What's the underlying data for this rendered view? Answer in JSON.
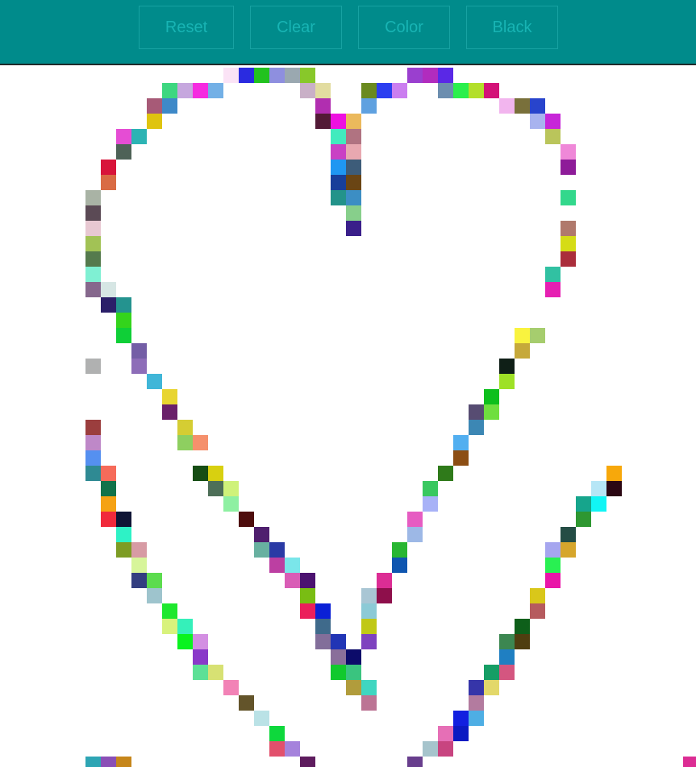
{
  "toolbar": {
    "reset_label": "Reset",
    "clear_label": "Clear",
    "color_label": "Color",
    "black_label": "Black",
    "background_color": "#008b8b",
    "button_text_color": "#18b4b4"
  },
  "canvas": {
    "background_color": "#ffffff",
    "pixels": [
      [
        "#fbe3f6",
        15,
        0
      ],
      [
        "#2a2be0",
        16,
        0
      ],
      [
        "#22c21f",
        17,
        0
      ],
      [
        "#8e8fdf",
        18,
        0
      ],
      [
        "#9aa8b0",
        19,
        0
      ],
      [
        "#88c82a",
        20,
        0
      ],
      [
        "#9a3fcf",
        27,
        0
      ],
      [
        "#b12cbe",
        28,
        0
      ],
      [
        "#5a28e6",
        29,
        0
      ],
      [
        "#3dd780",
        11,
        1
      ],
      [
        "#c6a7de",
        12,
        1
      ],
      [
        "#f52be0",
        13,
        1
      ],
      [
        "#73b0e6",
        14,
        1
      ],
      [
        "#c9b0c7",
        20,
        1
      ],
      [
        "#e2dca0",
        21,
        1
      ],
      [
        "#6a8a1f",
        24,
        1
      ],
      [
        "#2c3ef0",
        25,
        1
      ],
      [
        "#cb7ef0",
        26,
        1
      ],
      [
        "#6c8eaf",
        29,
        1
      ],
      [
        "#2bef4c",
        30,
        1
      ],
      [
        "#b3df2b",
        31,
        1
      ],
      [
        "#d31278",
        32,
        1
      ],
      [
        "#a75a77",
        10,
        2
      ],
      [
        "#3e89c8",
        11,
        2
      ],
      [
        "#b12eb0",
        21,
        2
      ],
      [
        "#5fa1e0",
        24,
        2
      ],
      [
        "#f2b5ee",
        33,
        2
      ],
      [
        "#79703b",
        34,
        2
      ],
      [
        "#2844cc",
        35,
        2
      ],
      [
        "#dfc40f",
        10,
        3
      ],
      [
        "#521a36",
        21,
        3
      ],
      [
        "#ee10e0",
        22,
        3
      ],
      [
        "#ebb95c",
        23,
        3
      ],
      [
        "#a8b3ef",
        35,
        3
      ],
      [
        "#c726d8",
        36,
        3
      ],
      [
        "#e54dd4",
        8,
        4
      ],
      [
        "#2cb4b4",
        9,
        4
      ],
      [
        "#41ebbe",
        22,
        4
      ],
      [
        "#b07381",
        23,
        4
      ],
      [
        "#bac55b",
        36,
        4
      ],
      [
        "#4e6257",
        8,
        5
      ],
      [
        "#c941c4",
        22,
        5
      ],
      [
        "#e8a8b0",
        23,
        5
      ],
      [
        "#ef88d8",
        37,
        5
      ],
      [
        "#d8143a",
        7,
        6
      ],
      [
        "#1f97f2",
        22,
        6
      ],
      [
        "#3d5c79",
        23,
        6
      ],
      [
        "#8e1c99",
        37,
        6
      ],
      [
        "#d96b44",
        7,
        7
      ],
      [
        "#183f9a",
        22,
        7
      ],
      [
        "#6a4514",
        23,
        7
      ],
      [
        "#a9b3a5",
        6,
        8
      ],
      [
        "#23938a",
        22,
        8
      ],
      [
        "#3c8ec4",
        23,
        8
      ],
      [
        "#33d88c",
        37,
        8
      ],
      [
        "#5b4a55",
        6,
        9
      ],
      [
        "#87cf8b",
        23,
        9
      ],
      [
        "#e8c8d2",
        6,
        10
      ],
      [
        "#3a1f8a",
        23,
        10
      ],
      [
        "#b0796c",
        37,
        10
      ],
      [
        "#a2c255",
        6,
        11
      ],
      [
        "#d5dc16",
        37,
        11
      ],
      [
        "#557a4d",
        6,
        12
      ],
      [
        "#aa2e3b",
        37,
        12
      ],
      [
        "#7ff0d3",
        6,
        13
      ],
      [
        "#31c1a2",
        36,
        13
      ],
      [
        "#86688d",
        6,
        14
      ],
      [
        "#d6e6e4",
        7,
        14
      ],
      [
        "#e620b2",
        36,
        14
      ],
      [
        "#2b1f69",
        7,
        15
      ],
      [
        "#24938f",
        8,
        15
      ],
      [
        "#34d41c",
        8,
        16
      ],
      [
        "#0fcf37",
        8,
        17
      ],
      [
        "#f9f33f",
        34,
        17
      ],
      [
        "#a6cd6e",
        35,
        17
      ],
      [
        "#745ea6",
        9,
        18
      ],
      [
        "#c6a93a",
        34,
        18
      ],
      [
        "#b0b1b1",
        6,
        19
      ],
      [
        "#8d6db8",
        9,
        19
      ],
      [
        "#0f1f17",
        33,
        19
      ],
      [
        "#40b6d8",
        10,
        20
      ],
      [
        "#9ee126",
        33,
        20
      ],
      [
        "#e8d531",
        11,
        21
      ],
      [
        "#0dbf1d",
        32,
        21
      ],
      [
        "#6a206a",
        11,
        22
      ],
      [
        "#574c72",
        31,
        22
      ],
      [
        "#6fdf3f",
        32,
        22
      ],
      [
        "#9b3e3e",
        6,
        23
      ],
      [
        "#d5cd33",
        12,
        23
      ],
      [
        "#3c87b4",
        31,
        23
      ],
      [
        "#be88c8",
        6,
        24
      ],
      [
        "#8ecf60",
        12,
        24
      ],
      [
        "#f5906c",
        13,
        24
      ],
      [
        "#52aff0",
        30,
        24
      ],
      [
        "#5590f0",
        6,
        25
      ],
      [
        "#8c4e14",
        30,
        25
      ],
      [
        "#2f8a93",
        6,
        26
      ],
      [
        "#f66b5a",
        7,
        26
      ],
      [
        "#164d14",
        13,
        26
      ],
      [
        "#d8d010",
        14,
        26
      ],
      [
        "#2f7a1a",
        29,
        26
      ],
      [
        "#f7a80b",
        40,
        26
      ],
      [
        "#11724a",
        7,
        27
      ],
      [
        "#4e6f58",
        14,
        27
      ],
      [
        "#cff27a",
        15,
        27
      ],
      [
        "#39c860",
        28,
        27
      ],
      [
        "#b6e6f6",
        39,
        27
      ],
      [
        "#2b0713",
        40,
        27
      ],
      [
        "#f5a214",
        7,
        28
      ],
      [
        "#8ef0a2",
        15,
        28
      ],
      [
        "#a8b2f7",
        28,
        28
      ],
      [
        "#16a58c",
        38,
        28
      ],
      [
        "#11f5f5",
        39,
        28
      ],
      [
        "#f12a3b",
        7,
        29
      ],
      [
        "#0f1535",
        8,
        29
      ],
      [
        "#4e0d0d",
        16,
        29
      ],
      [
        "#e65cc2",
        27,
        29
      ],
      [
        "#2e9731",
        38,
        29
      ],
      [
        "#2ef2c6",
        8,
        30
      ],
      [
        "#4f1f6e",
        17,
        30
      ],
      [
        "#9db8e6",
        27,
        30
      ],
      [
        "#244d45",
        37,
        30
      ],
      [
        "#7d9c24",
        8,
        31
      ],
      [
        "#d79ba4",
        9,
        31
      ],
      [
        "#68b0a0",
        17,
        31
      ],
      [
        "#2a3aa5",
        18,
        31
      ],
      [
        "#28b632",
        26,
        31
      ],
      [
        "#a6a6ef",
        36,
        31
      ],
      [
        "#d6a62c",
        37,
        31
      ],
      [
        "#d7f59a",
        9,
        32
      ],
      [
        "#bc3fa2",
        18,
        32
      ],
      [
        "#7ae6ea",
        19,
        32
      ],
      [
        "#0f56b0",
        26,
        32
      ],
      [
        "#29f052",
        36,
        32
      ],
      [
        "#333e80",
        9,
        33
      ],
      [
        "#5cdc4e",
        10,
        33
      ],
      [
        "#d95db6",
        19,
        33
      ],
      [
        "#4b1270",
        20,
        33
      ],
      [
        "#dc2d94",
        25,
        33
      ],
      [
        "#e916a8",
        36,
        33
      ],
      [
        "#9ec4cd",
        10,
        34
      ],
      [
        "#79bd13",
        20,
        34
      ],
      [
        "#a9c6d4",
        24,
        34
      ],
      [
        "#8e0f4b",
        25,
        34
      ],
      [
        "#d9c71a",
        35,
        34
      ],
      [
        "#1ee82e",
        11,
        35
      ],
      [
        "#eb1f5b",
        20,
        35
      ],
      [
        "#0b20d6",
        21,
        35
      ],
      [
        "#8ccad6",
        24,
        35
      ],
      [
        "#b65b5e",
        35,
        35
      ],
      [
        "#d8f27c",
        11,
        36
      ],
      [
        "#35f0ba",
        12,
        36
      ],
      [
        "#3f6a8b",
        21,
        36
      ],
      [
        "#c0c816",
        24,
        36
      ],
      [
        "#0e5f1a",
        34,
        36
      ],
      [
        "#0af31f",
        12,
        37
      ],
      [
        "#d38fe2",
        13,
        37
      ],
      [
        "#826e9a",
        21,
        37
      ],
      [
        "#2135b5",
        22,
        37
      ],
      [
        "#7e42bf",
        24,
        37
      ],
      [
        "#3c8751",
        33,
        37
      ],
      [
        "#4f3e10",
        34,
        37
      ],
      [
        "#8a39c9",
        13,
        38
      ],
      [
        "#8a6f9a",
        22,
        38
      ],
      [
        "#0c0b6a",
        23,
        38
      ],
      [
        "#1f7fc2",
        33,
        38
      ],
      [
        "#5de096",
        13,
        39
      ],
      [
        "#d7e173",
        14,
        39
      ],
      [
        "#11c92d",
        22,
        39
      ],
      [
        "#3ac47f",
        23,
        39
      ],
      [
        "#169e65",
        32,
        39
      ],
      [
        "#d45680",
        33,
        39
      ],
      [
        "#f282b6",
        15,
        40
      ],
      [
        "#b19c3c",
        23,
        40
      ],
      [
        "#3fd6c0",
        24,
        40
      ],
      [
        "#3635a9",
        31,
        40
      ],
      [
        "#e3d86a",
        32,
        40
      ],
      [
        "#63542a",
        16,
        41
      ],
      [
        "#bc7494",
        24,
        41
      ],
      [
        "#b37b9f",
        31,
        41
      ],
      [
        "#bae2e6",
        17,
        42
      ],
      [
        "#1220e0",
        30,
        42
      ],
      [
        "#4eaee4",
        31,
        42
      ],
      [
        "#0ed83c",
        18,
        43
      ],
      [
        "#e66fb6",
        29,
        43
      ],
      [
        "#0c1ac2",
        30,
        43
      ],
      [
        "#e2506c",
        18,
        44
      ],
      [
        "#a582dc",
        19,
        44
      ],
      [
        "#a6c4cc",
        28,
        44
      ],
      [
        "#c84480",
        29,
        44
      ],
      [
        "#2ea5b4",
        6,
        45
      ],
      [
        "#8a4fb6",
        7,
        45
      ],
      [
        "#c6861b",
        8,
        45
      ],
      [
        "#5e1c5e",
        20,
        45
      ],
      [
        "#683e8d",
        27,
        45
      ],
      [
        "#dc2d94",
        45,
        45
      ]
    ]
  }
}
